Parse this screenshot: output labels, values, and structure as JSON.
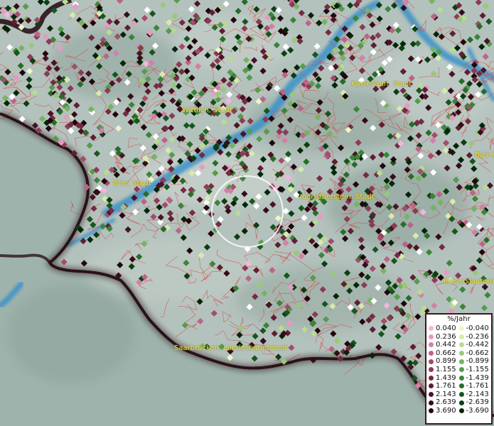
{
  "cities": [
    {
      "id": "kastellaun",
      "name": "Kastellaun, Stadt"
    },
    {
      "id": "wittlich",
      "name": "Wittlich, Stadt"
    },
    {
      "id": "bad",
      "name": "Bad K"
    },
    {
      "id": "trier",
      "name": "Trier, Stadt"
    },
    {
      "id": "idar",
      "name": "Idar-Oberstein, Stadt"
    },
    {
      "id": "kaiserslautern",
      "name": "Kaiserslautern"
    },
    {
      "id": "saarbruecken",
      "name": "Saarbrücken, Landeshauptstadt"
    }
  ],
  "legend": {
    "title": "%/Jahr",
    "positive": [
      {
        "label": "0.040",
        "color": "#f2b6dd"
      },
      {
        "label": "0.236",
        "color": "#e79ac3"
      },
      {
        "label": "0.442",
        "color": "#d37fa8"
      },
      {
        "label": "0.662",
        "color": "#bd6388"
      },
      {
        "label": "0.899",
        "color": "#a34c6c"
      },
      {
        "label": "1.155",
        "color": "#8c3a55"
      },
      {
        "label": "1.439",
        "color": "#752b42"
      },
      {
        "label": "1.761",
        "color": "#5f1e31"
      },
      {
        "label": "2.143",
        "color": "#4a1424"
      },
      {
        "label": "2.639",
        "color": "#360c18"
      },
      {
        "label": "3.690",
        "color": "#22050c"
      }
    ],
    "negative": [
      {
        "label": "-0.040",
        "color": "#ecf6c8"
      },
      {
        "label": "-0.236",
        "color": "#d5ebad"
      },
      {
        "label": "-0.442",
        "color": "#b8dc90"
      },
      {
        "label": "-0.662",
        "color": "#98c979"
      },
      {
        "label": "-0.899",
        "color": "#77b363"
      },
      {
        "label": "-1.155",
        "color": "#579b4c"
      },
      {
        "label": "-1.439",
        "color": "#3c8439"
      },
      {
        "label": "-1.761",
        "color": "#276d2a"
      },
      {
        "label": "-2.143",
        "color": "#17561d"
      },
      {
        "label": "-2.639",
        "color": "#0b3f12"
      },
      {
        "label": "-3.690",
        "color": "#032608"
      }
    ]
  },
  "colors": {
    "terrain": "#a8b8b0",
    "water": "#3a92c8",
    "border": "#2a1218",
    "district_lines": "#d84848",
    "label": "#e8e23a",
    "focus_ring": "#ffffff",
    "point_white": "#ffffff"
  }
}
